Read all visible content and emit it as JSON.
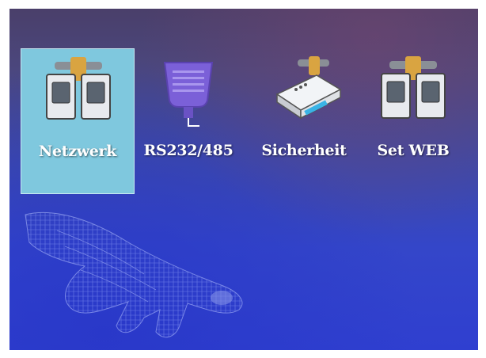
{
  "menu": {
    "items": [
      {
        "label": "Netzwerk",
        "icon": "network-icon",
        "selected": true
      },
      {
        "label": "RS232/485",
        "icon": "serial-port-icon",
        "selected": false
      },
      {
        "label": "Sicherheit",
        "icon": "security-device-icon",
        "selected": false
      },
      {
        "label": "Set WEB",
        "icon": "web-network-icon",
        "selected": false
      }
    ]
  },
  "colors": {
    "selection_highlight": "#7fc8de",
    "screen_top": "#4a3f6a",
    "screen_bottom": "#2f3fd0",
    "label_text": "#ffffff"
  }
}
